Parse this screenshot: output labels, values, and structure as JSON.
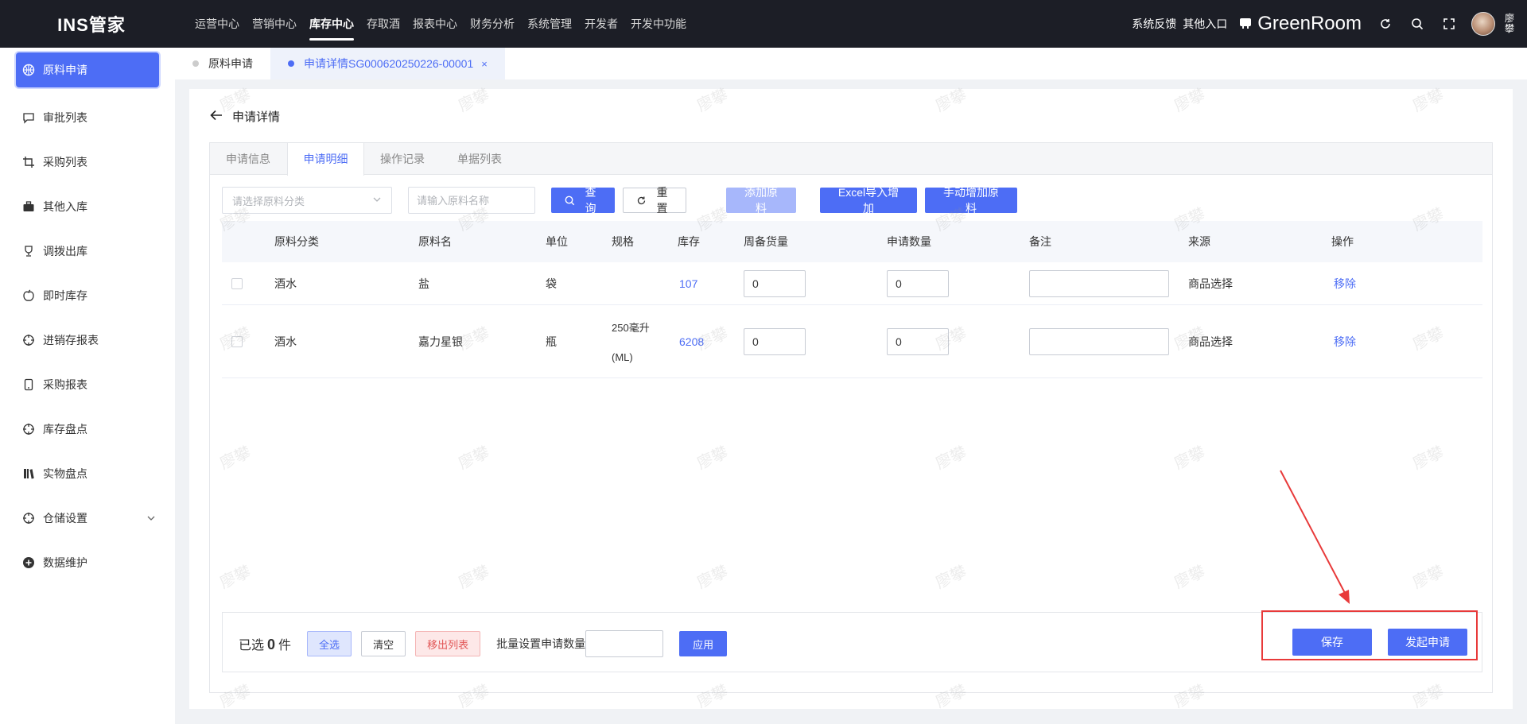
{
  "app": {
    "logo": "INS管家",
    "top_nav": [
      {
        "label": "运营中心",
        "active": false
      },
      {
        "label": "营销中心",
        "active": false
      },
      {
        "label": "库存中心",
        "active": true
      },
      {
        "label": "存取酒",
        "active": false
      },
      {
        "label": "报表中心",
        "active": false
      },
      {
        "label": "财务分析",
        "active": false
      },
      {
        "label": "系统管理",
        "active": false
      },
      {
        "label": "开发者",
        "active": false
      },
      {
        "label": "开发中功能",
        "active": false
      }
    ],
    "feedback": "系统反馈",
    "other_entry": "其他入口",
    "store_name": "GreenRoom",
    "user_name": "廖攀"
  },
  "sidebar": {
    "items": [
      {
        "label": "原料申请",
        "icon": "basketball-icon",
        "active": true
      },
      {
        "label": "审批列表",
        "icon": "chat-icon"
      },
      {
        "label": "采购列表",
        "icon": "crop-icon"
      },
      {
        "label": "其他入库",
        "icon": "briefcase-icon"
      },
      {
        "label": "调拨出库",
        "icon": "trophy-icon"
      },
      {
        "label": "即时库存",
        "icon": "apple-icon"
      },
      {
        "label": "进销存报表",
        "icon": "target-icon"
      },
      {
        "label": "采购报表",
        "icon": "phone-icon"
      },
      {
        "label": "库存盘点",
        "icon": "target-icon"
      },
      {
        "label": "实物盘点",
        "icon": "books-icon"
      },
      {
        "label": "仓储设置",
        "icon": "target-icon",
        "expandable": true
      },
      {
        "label": "数据维护",
        "icon": "plus-circle-icon"
      }
    ]
  },
  "page_tabs": [
    {
      "label": "原料申请",
      "active": false
    },
    {
      "label": "申请详情SG000620250226-00001",
      "active": true,
      "close": "×"
    }
  ],
  "page": {
    "title": "申请详情",
    "sub_tabs": [
      {
        "label": "申请信息",
        "active": false
      },
      {
        "label": "申请明细",
        "active": true
      },
      {
        "label": "操作记录",
        "active": false
      },
      {
        "label": "单据列表",
        "active": false
      }
    ],
    "filters": {
      "category_placeholder": "请选择原料分类",
      "name_placeholder": "请输入原料名称",
      "query_label": "查询",
      "reset_label": "重置",
      "add_label": "添加原料",
      "excel_label": "Excel导入增加",
      "manual_label": "手动增加原料"
    },
    "table": {
      "columns": [
        "原料分类",
        "原料名",
        "单位",
        "规格",
        "库存",
        "周备货量",
        "申请数量",
        "备注",
        "来源",
        "操作"
      ],
      "rows": [
        {
          "category": "酒水",
          "name": "盐",
          "unit": "袋",
          "spec1": "",
          "spec2": "",
          "stock": "107",
          "weekly": "0",
          "qty": "0",
          "note": "",
          "source": "商品选择",
          "action": "移除"
        },
        {
          "category": "酒水",
          "name": "嘉力星银",
          "unit": "瓶",
          "spec1": "250毫升",
          "spec2": "(ML)",
          "stock": "6208",
          "weekly": "0",
          "qty": "0",
          "note": "",
          "source": "商品选择",
          "action": "移除"
        }
      ]
    },
    "footer": {
      "selected_prefix": "已选",
      "selected_count": "0",
      "selected_suffix": "件",
      "select_all": "全选",
      "clear": "清空",
      "remove_list": "移出列表",
      "batch_label": "批量设置申请数量",
      "apply": "应用",
      "save": "保存",
      "submit": "发起申请"
    },
    "watermark": "廖攀"
  },
  "colors": {
    "primary": "#4d6df5",
    "topbar": "#1c1e26",
    "annotation": "#e83a3a",
    "danger": "#e25656"
  }
}
